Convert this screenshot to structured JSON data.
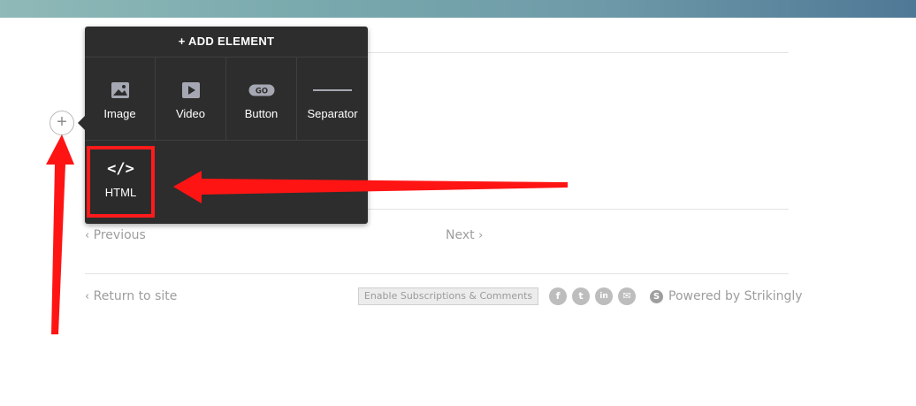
{
  "add_element_panel": {
    "title": "+ ADD ELEMENT",
    "items": [
      {
        "label": "Image",
        "icon": "image-icon"
      },
      {
        "label": "Video",
        "icon": "video-play-icon"
      },
      {
        "label": "Button",
        "icon": "go-button-icon",
        "icon_text": "GO"
      },
      {
        "label": "Separator",
        "icon": "separator-line-icon"
      }
    ],
    "html_item": {
      "label": "HTML",
      "icon_text": "</>"
    }
  },
  "add_button": {
    "symbol": "+"
  },
  "pagination": {
    "previous": "Previous",
    "next": "Next"
  },
  "footer": {
    "return_link": "Return to site",
    "subscribe_button": "Enable Subscriptions & Comments",
    "social": [
      {
        "name": "facebook-icon",
        "glyph": "f"
      },
      {
        "name": "twitter-icon",
        "glyph": "t"
      },
      {
        "name": "linkedin-icon",
        "glyph": "in"
      },
      {
        "name": "email-icon",
        "glyph": "✉"
      }
    ],
    "powered_badge": "S",
    "powered_by": "Powered by Strikingly"
  },
  "colors": {
    "panel_bg": "#2d2d2d",
    "highlight_red": "#ff1b1b",
    "muted_text": "#9d9d9d"
  }
}
